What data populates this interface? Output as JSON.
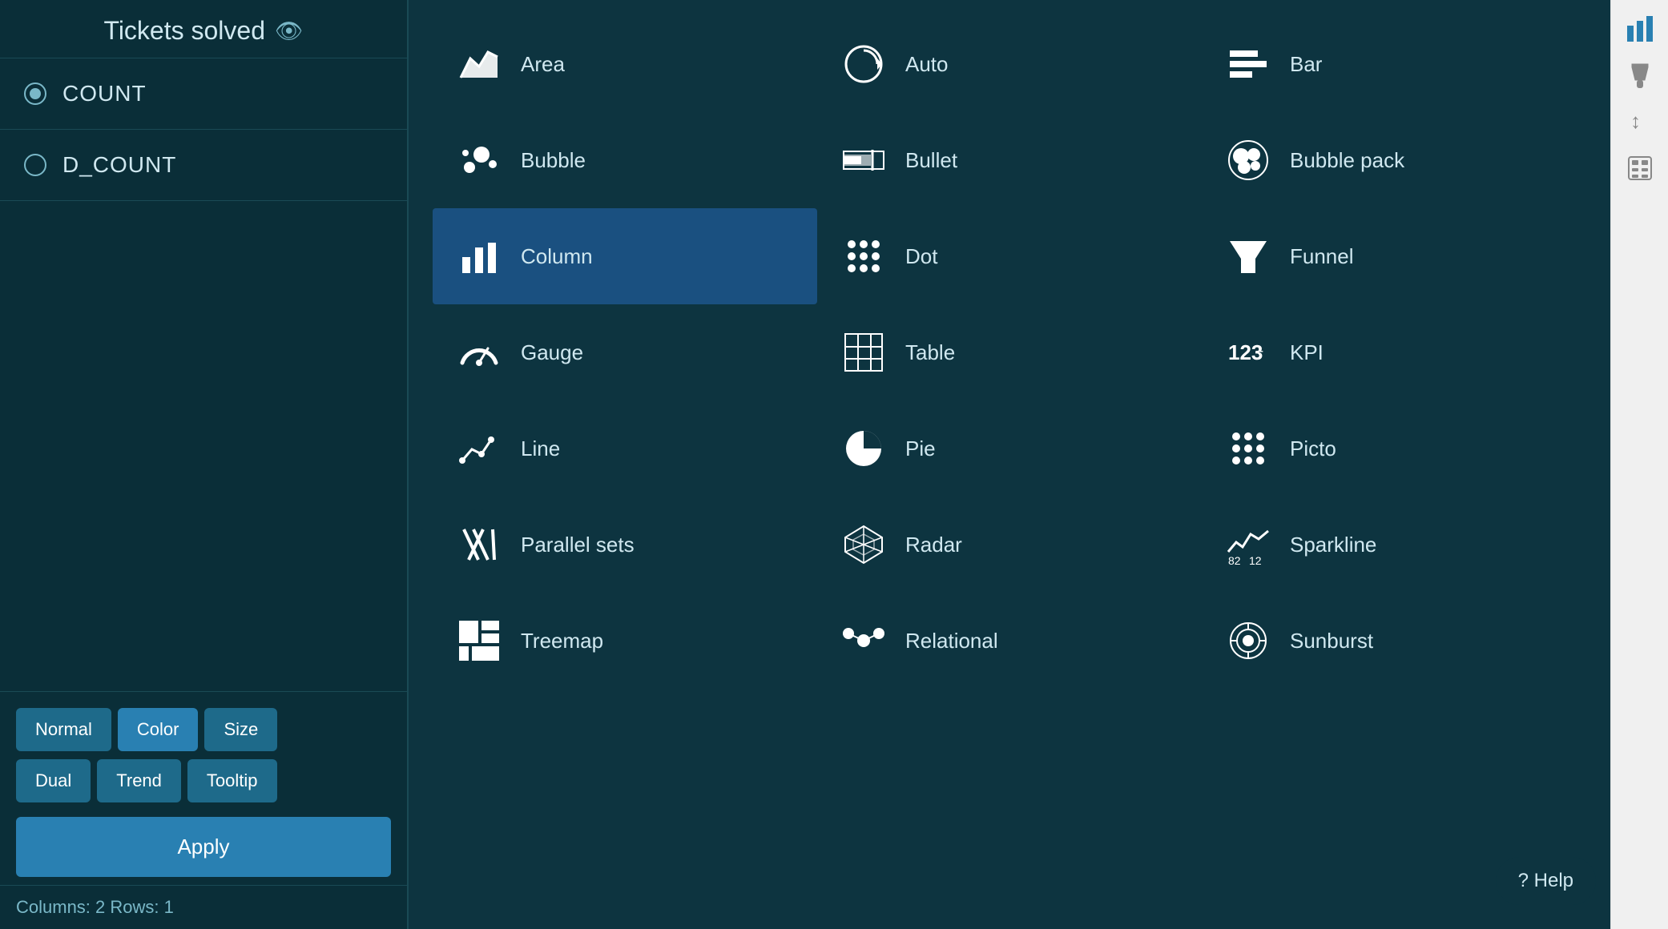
{
  "left_panel": {
    "title": "Tickets solved",
    "metrics": [
      {
        "id": "count",
        "label": "COUNT",
        "selected": true
      },
      {
        "id": "dcount",
        "label": "D_COUNT",
        "selected": false
      }
    ],
    "buttons_row1": [
      {
        "id": "normal",
        "label": "Normal",
        "active": false
      },
      {
        "id": "color",
        "label": "Color",
        "active": true
      },
      {
        "id": "size",
        "label": "Size",
        "active": false
      }
    ],
    "buttons_row2": [
      {
        "id": "dual",
        "label": "Dual",
        "active": false
      },
      {
        "id": "trend",
        "label": "Trend",
        "active": false
      },
      {
        "id": "tooltip",
        "label": "Tooltip",
        "active": false
      }
    ],
    "apply_label": "Apply",
    "status": "Columns: 2    Rows: 1"
  },
  "chart_types": [
    {
      "id": "area",
      "label": "Area",
      "selected": false
    },
    {
      "id": "auto",
      "label": "Auto",
      "selected": false
    },
    {
      "id": "bar",
      "label": "Bar",
      "selected": false
    },
    {
      "id": "bubble",
      "label": "Bubble",
      "selected": false
    },
    {
      "id": "bullet",
      "label": "Bullet",
      "selected": false
    },
    {
      "id": "bubble-pack",
      "label": "Bubble pack",
      "selected": false
    },
    {
      "id": "column",
      "label": "Column",
      "selected": true
    },
    {
      "id": "dot",
      "label": "Dot",
      "selected": false
    },
    {
      "id": "funnel",
      "label": "Funnel",
      "selected": false
    },
    {
      "id": "gauge",
      "label": "Gauge",
      "selected": false
    },
    {
      "id": "table",
      "label": "Table",
      "selected": false
    },
    {
      "id": "kpi",
      "label": "KPI",
      "selected": false
    },
    {
      "id": "line",
      "label": "Line",
      "selected": false
    },
    {
      "id": "pie",
      "label": "Pie",
      "selected": false
    },
    {
      "id": "picto",
      "label": "Picto",
      "selected": false
    },
    {
      "id": "parallel-sets",
      "label": "Parallel sets",
      "selected": false
    },
    {
      "id": "radar",
      "label": "Radar",
      "selected": false
    },
    {
      "id": "sparkline",
      "label": "Sparkline",
      "selected": false
    },
    {
      "id": "treemap",
      "label": "Treemap",
      "selected": false
    },
    {
      "id": "relational",
      "label": "Relational",
      "selected": false
    },
    {
      "id": "sunburst",
      "label": "Sunburst",
      "selected": false
    }
  ],
  "right_sidebar": {
    "icons": [
      {
        "id": "bar-chart",
        "symbol": "📊"
      },
      {
        "id": "brush",
        "symbol": "🖌"
      },
      {
        "id": "sort",
        "symbol": "↕"
      },
      {
        "id": "calc",
        "symbol": "🖩"
      }
    ]
  },
  "help_label": "? Help"
}
